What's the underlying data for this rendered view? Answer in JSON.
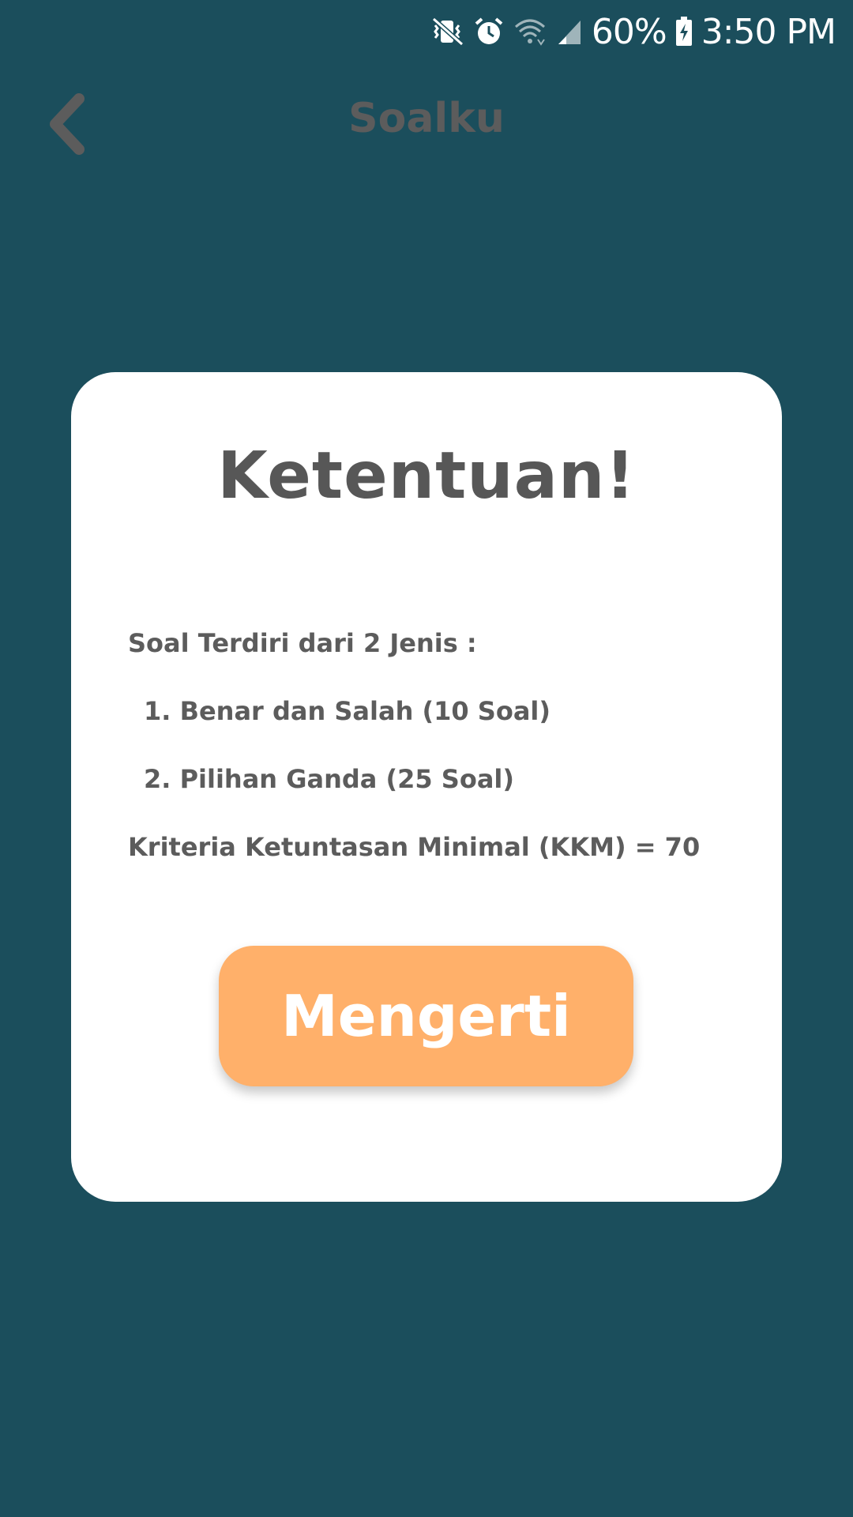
{
  "status_bar": {
    "battery": "60%",
    "time": "3:50 PM",
    "icons": [
      "vibrate-mute-icon",
      "alarm-icon",
      "wifi-icon",
      "signal-icon",
      "battery-charging-icon"
    ]
  },
  "app_bar": {
    "title": "Soalku",
    "back_icon": "chevron-left-icon"
  },
  "dialog": {
    "title": "Ketentuan!",
    "rules": [
      "Soal Terdiri dari 2 Jenis :",
      "1. Benar dan Salah (10 Soal)",
      "2. Pilihan Ganda (25 Soal)",
      "Kriteria Ketuntasan Minimal (KKM) = 70"
    ],
    "confirm_label": "Mengerti"
  },
  "colors": {
    "background": "#1b4e5c",
    "card": "#ffffff",
    "text": "#5c5c5c",
    "button": "#ffb06a",
    "button_text": "#ffffff"
  }
}
